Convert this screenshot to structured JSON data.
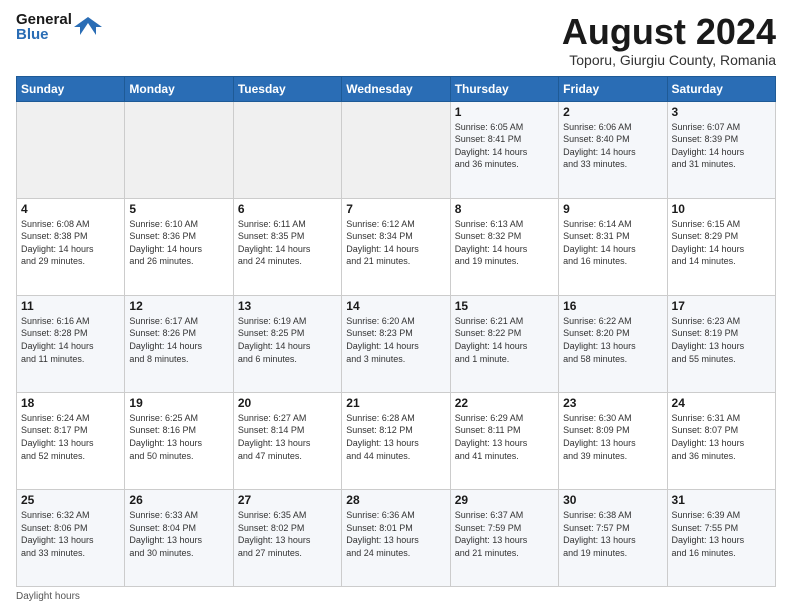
{
  "logo": {
    "line1": "General",
    "line2": "Blue"
  },
  "title": "August 2024",
  "subtitle": "Toporu, Giurgiu County, Romania",
  "header_days": [
    "Sunday",
    "Monday",
    "Tuesday",
    "Wednesday",
    "Thursday",
    "Friday",
    "Saturday"
  ],
  "footer": "Daylight hours",
  "weeks": [
    [
      {
        "day": "",
        "info": ""
      },
      {
        "day": "",
        "info": ""
      },
      {
        "day": "",
        "info": ""
      },
      {
        "day": "",
        "info": ""
      },
      {
        "day": "1",
        "info": "Sunrise: 6:05 AM\nSunset: 8:41 PM\nDaylight: 14 hours\nand 36 minutes."
      },
      {
        "day": "2",
        "info": "Sunrise: 6:06 AM\nSunset: 8:40 PM\nDaylight: 14 hours\nand 33 minutes."
      },
      {
        "day": "3",
        "info": "Sunrise: 6:07 AM\nSunset: 8:39 PM\nDaylight: 14 hours\nand 31 minutes."
      }
    ],
    [
      {
        "day": "4",
        "info": "Sunrise: 6:08 AM\nSunset: 8:38 PM\nDaylight: 14 hours\nand 29 minutes."
      },
      {
        "day": "5",
        "info": "Sunrise: 6:10 AM\nSunset: 8:36 PM\nDaylight: 14 hours\nand 26 minutes."
      },
      {
        "day": "6",
        "info": "Sunrise: 6:11 AM\nSunset: 8:35 PM\nDaylight: 14 hours\nand 24 minutes."
      },
      {
        "day": "7",
        "info": "Sunrise: 6:12 AM\nSunset: 8:34 PM\nDaylight: 14 hours\nand 21 minutes."
      },
      {
        "day": "8",
        "info": "Sunrise: 6:13 AM\nSunset: 8:32 PM\nDaylight: 14 hours\nand 19 minutes."
      },
      {
        "day": "9",
        "info": "Sunrise: 6:14 AM\nSunset: 8:31 PM\nDaylight: 14 hours\nand 16 minutes."
      },
      {
        "day": "10",
        "info": "Sunrise: 6:15 AM\nSunset: 8:29 PM\nDaylight: 14 hours\nand 14 minutes."
      }
    ],
    [
      {
        "day": "11",
        "info": "Sunrise: 6:16 AM\nSunset: 8:28 PM\nDaylight: 14 hours\nand 11 minutes."
      },
      {
        "day": "12",
        "info": "Sunrise: 6:17 AM\nSunset: 8:26 PM\nDaylight: 14 hours\nand 8 minutes."
      },
      {
        "day": "13",
        "info": "Sunrise: 6:19 AM\nSunset: 8:25 PM\nDaylight: 14 hours\nand 6 minutes."
      },
      {
        "day": "14",
        "info": "Sunrise: 6:20 AM\nSunset: 8:23 PM\nDaylight: 14 hours\nand 3 minutes."
      },
      {
        "day": "15",
        "info": "Sunrise: 6:21 AM\nSunset: 8:22 PM\nDaylight: 14 hours\nand 1 minute."
      },
      {
        "day": "16",
        "info": "Sunrise: 6:22 AM\nSunset: 8:20 PM\nDaylight: 13 hours\nand 58 minutes."
      },
      {
        "day": "17",
        "info": "Sunrise: 6:23 AM\nSunset: 8:19 PM\nDaylight: 13 hours\nand 55 minutes."
      }
    ],
    [
      {
        "day": "18",
        "info": "Sunrise: 6:24 AM\nSunset: 8:17 PM\nDaylight: 13 hours\nand 52 minutes."
      },
      {
        "day": "19",
        "info": "Sunrise: 6:25 AM\nSunset: 8:16 PM\nDaylight: 13 hours\nand 50 minutes."
      },
      {
        "day": "20",
        "info": "Sunrise: 6:27 AM\nSunset: 8:14 PM\nDaylight: 13 hours\nand 47 minutes."
      },
      {
        "day": "21",
        "info": "Sunrise: 6:28 AM\nSunset: 8:12 PM\nDaylight: 13 hours\nand 44 minutes."
      },
      {
        "day": "22",
        "info": "Sunrise: 6:29 AM\nSunset: 8:11 PM\nDaylight: 13 hours\nand 41 minutes."
      },
      {
        "day": "23",
        "info": "Sunrise: 6:30 AM\nSunset: 8:09 PM\nDaylight: 13 hours\nand 39 minutes."
      },
      {
        "day": "24",
        "info": "Sunrise: 6:31 AM\nSunset: 8:07 PM\nDaylight: 13 hours\nand 36 minutes."
      }
    ],
    [
      {
        "day": "25",
        "info": "Sunrise: 6:32 AM\nSunset: 8:06 PM\nDaylight: 13 hours\nand 33 minutes."
      },
      {
        "day": "26",
        "info": "Sunrise: 6:33 AM\nSunset: 8:04 PM\nDaylight: 13 hours\nand 30 minutes."
      },
      {
        "day": "27",
        "info": "Sunrise: 6:35 AM\nSunset: 8:02 PM\nDaylight: 13 hours\nand 27 minutes."
      },
      {
        "day": "28",
        "info": "Sunrise: 6:36 AM\nSunset: 8:01 PM\nDaylight: 13 hours\nand 24 minutes."
      },
      {
        "day": "29",
        "info": "Sunrise: 6:37 AM\nSunset: 7:59 PM\nDaylight: 13 hours\nand 21 minutes."
      },
      {
        "day": "30",
        "info": "Sunrise: 6:38 AM\nSunset: 7:57 PM\nDaylight: 13 hours\nand 19 minutes."
      },
      {
        "day": "31",
        "info": "Sunrise: 6:39 AM\nSunset: 7:55 PM\nDaylight: 13 hours\nand 16 minutes."
      }
    ]
  ]
}
